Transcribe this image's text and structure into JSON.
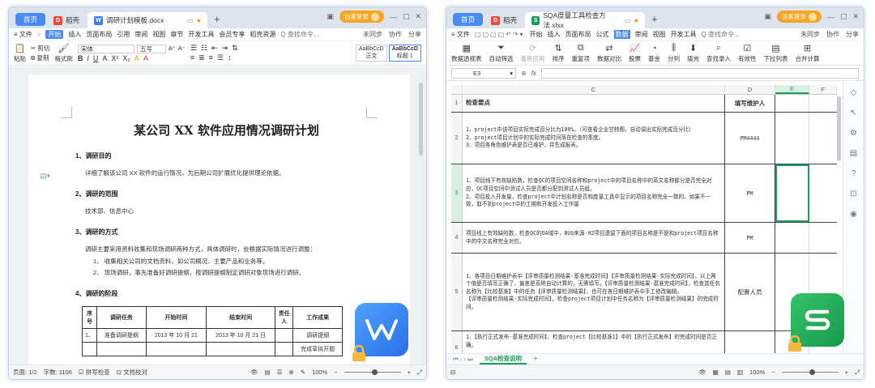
{
  "writer": {
    "tabs": {
      "home": "首页",
      "daoke": "稻壳",
      "doc": "调研计划模板.docx"
    },
    "login": "访客登录",
    "menu": {
      "file": "≡ 文件",
      "items": [
        "开始",
        "插入",
        "页面布局",
        "引用",
        "审阅",
        "视图",
        "章节",
        "开发工具",
        "会员专享",
        "稻壳资源"
      ],
      "search": "Q 查找命令...",
      "right": [
        "未同步",
        "协作",
        "分享"
      ]
    },
    "ribbon": {
      "paste": "粘贴",
      "cut": "剪切",
      "copy": "复制",
      "format_painter": "格式刷",
      "font": "宋体",
      "size": "五号",
      "styles": [
        "AaBbCcD",
        "AaBbCcD"
      ],
      "style_names": [
        "正文",
        "标题 1"
      ]
    },
    "document": {
      "title": "某公司 XX 软件应用情况调研计划",
      "sections": [
        {
          "heading": "1、调研目的",
          "text": "详细了解该公司 XX 软件的运行情况，为后期公司扩展优化提供理论依据。"
        },
        {
          "heading": "2、调研的范围",
          "text": "技术部、信息中心"
        },
        {
          "heading": "3、调研的方式",
          "text": "调研主要采用资料收集和现场调研两种方式，具体调研时，会根据实际情况进行调整："
        }
      ],
      "list": [
        "1、 收集相关公司的文档资料，如公司概况、主要产品和业务等。",
        "2、 现场调研，事先准备好调研提纲，按调研提纲制定调研对象现场进行调研。"
      ],
      "heading4": "4、调研的阶段",
      "table": {
        "headers": [
          "序号",
          "调研任务",
          "开始时间",
          "结束时间",
          "责任人",
          "工作成果"
        ],
        "rows": [
          [
            "1、",
            "准备调研提纲",
            "2013 年 10 月 21",
            "2013 年 10 月 21 日",
            "",
            "调研提纲"
          ],
          [
            "",
            "",
            "",
            "",
            "",
            "完成草拟开题"
          ]
        ]
      }
    },
    "status": {
      "page": "页面: 1/2",
      "words": "字数: 1106",
      "spell": "拼写检查",
      "proof": "文档校对",
      "zoom": "100%"
    }
  },
  "sheet": {
    "tabs": {
      "home": "首页",
      "daoke": "稻壳",
      "doc": "SQA度量工具检查方法.xlsx"
    },
    "login": "访客登录",
    "menu": {
      "file": "≡ 文件",
      "items": [
        "开始",
        "插入",
        "页面布局",
        "公式",
        "数据",
        "审阅",
        "视图",
        "开发工具"
      ],
      "search": "Q 查找命令...",
      "right": [
        "未同步",
        "协作",
        "分享"
      ]
    },
    "ribbon": [
      "数据透视表",
      "自动筛选",
      "重新应用",
      "排序",
      "重复项",
      "数据对比",
      "股票",
      "基金",
      "分列",
      "填充",
      "查找录入",
      "有效性",
      "下拉列表",
      "合并计算"
    ],
    "namebox": "E3",
    "fx": "fx",
    "columns": [
      "C",
      "D",
      "E",
      "F"
    ],
    "rows": [
      {
        "n": "1",
        "c": "检查要点",
        "d": "填写维护人"
      },
      {
        "n": "2",
        "c": "1、project中该项目实际完成百分比为100%。（可查看企业甘特图，自动调出实际完成百分比）\n2、project项目计划中的实际完成时间落在检查的季度。\n3、项目各角色维护表是否已维护，并生成报表。",
        "d": "PM4444"
      },
      {
        "n": "3",
        "c": "1、项目线下有效缺陷数，检查QC的项目空间名称和project中的项目名称中的英文名称部分是否完全对应，QC项目空间中测试人员是否都分配到测试人员组。\n2、项目投入开发量，检查project中计划名称是否和度量工具中显示的项目名称完全一致的。如果不一致，取不到project中的工期和开发投入工作量",
        "d": "PM"
      },
      {
        "n": "4",
        "c": "项目线上有效缺陷数，检查QC的OA域中，BUG来源-02项目遗留下面的项目名称是不是和project项目名称中的中文名称完全对应。",
        "d": "PM"
      },
      {
        "n": "5",
        "c": "1、各项目日期维护表中【评审质量检测结果-基准完成时间】【评审质量检测结果-实际完成时间】，以上两个值是否填写正确了，偏差是系统自动计算的，无需填写。【评审质量检测结果-基准完成时间】，检查其任务名称为【比较基准】中的任务【评审质量检测结果】，也可在各日期维护表中手工修改编辑。\n【评审质量检测结果-实际完成时间】，检查project项目计划中任务名称为【评审质量检测结果】的完成时间。",
        "d": "配置人员"
      },
      {
        "n": "6",
        "c": "1、【执行正式发布-基准完成时间】，检查project【比较基准1】中的【执行正式发布】的完成时间是否正确。",
        "d": ""
      }
    ],
    "sheet_tab": "SQA检查说明",
    "status": {
      "zoom": "100%"
    }
  }
}
